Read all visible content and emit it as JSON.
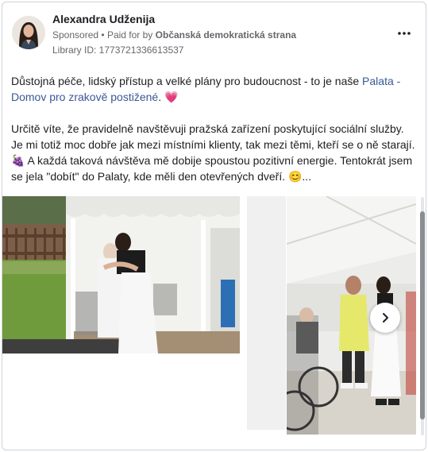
{
  "post": {
    "author": "Alexandra Udženija",
    "sponsored": "Sponsored",
    "separator": "•",
    "paid_for_prefix": "Paid for by",
    "paid_for_by": "Občanská demokratická strana",
    "library_id": "Library ID: 1773721336613537",
    "more_icon": "more-horizontal-icon",
    "text": {
      "p1_before": "Důstojná péče, lidský přístup a velké plány pro budoucnost - to je naše ",
      "p1_link": "Palata - Domov pro zrakově postižené",
      "p1_after": ". ",
      "p1_emoji": "💗",
      "p2_start": "Určitě víte, že pravidelně navštěvuji pražská zařízení poskytující sociální služby. Je mi totiž moc dobře jak mezi místními klienty, tak mezi těmi, kteří se o ně starají.",
      "p2_emoji1": "🍇",
      "p2_mid": " A každá taková návštěva mě dobije spoustou pozitivní energie. Tentokrát jsem se jela \"dobít\" do Palaty, kde měli den otevřených dveří. ",
      "p2_emoji2": "😊",
      "p2_end": "..."
    }
  },
  "carousel": {
    "next_icon": "chevron-right-icon",
    "colors": {
      "tent": "#f2f2ef",
      "grass": "#6f9b3c",
      "yellow_top": "#e5e86a"
    }
  }
}
